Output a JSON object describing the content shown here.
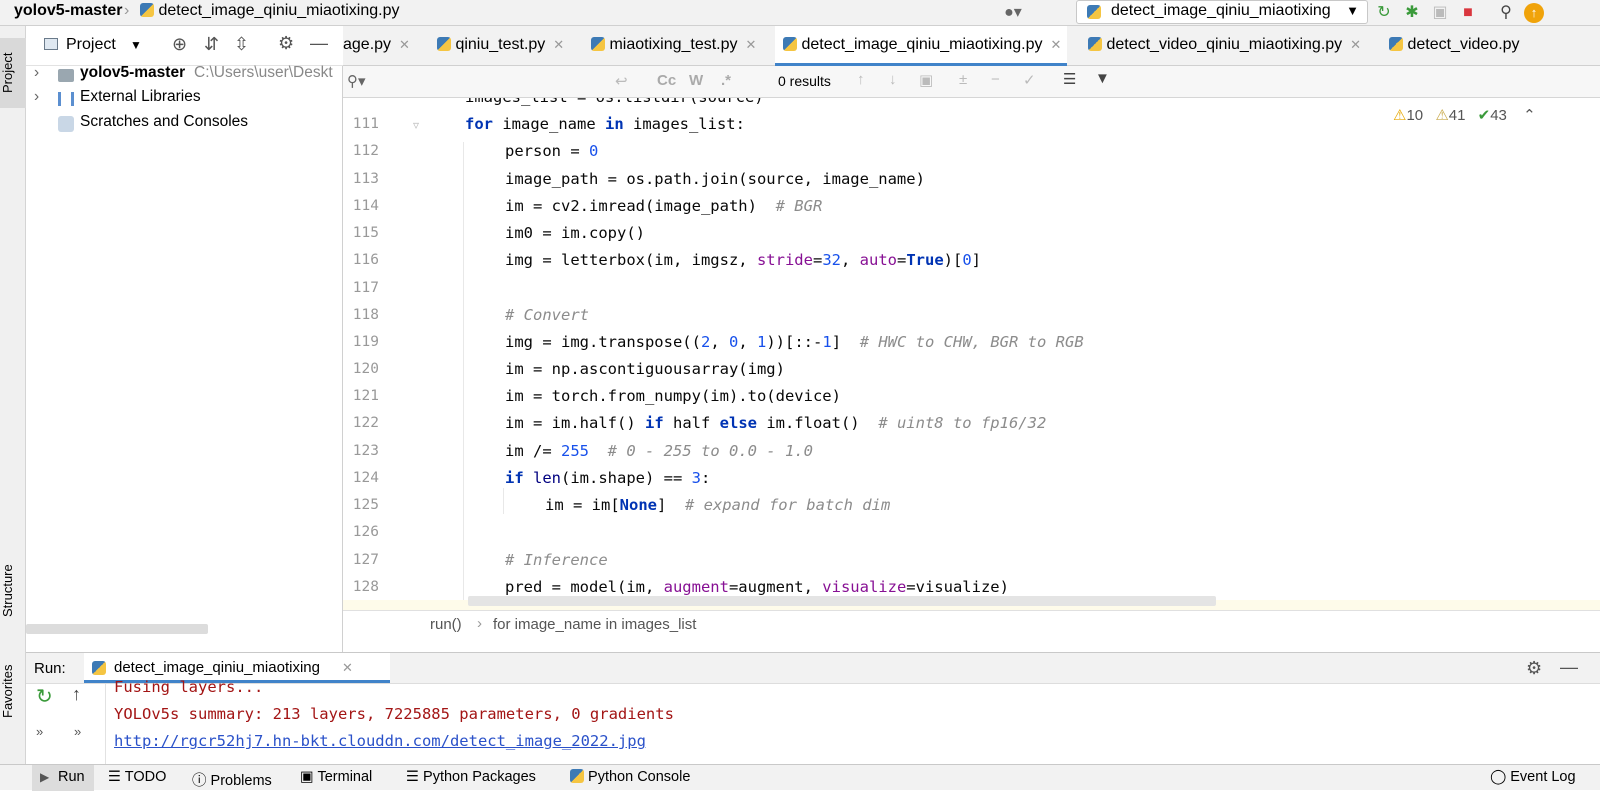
{
  "titlebar": {
    "project": "yolov5-master",
    "file": "detect_image_qiniu_miaotixing.py",
    "run_config": "detect_image_qiniu_miaotixing"
  },
  "sidebar_strip": {
    "project": "Project",
    "structure": "Structure",
    "favorites": "Favorites"
  },
  "project_panel": {
    "title": "Project",
    "items": [
      {
        "label": "yolov5-master",
        "path": "C:\\Users\\user\\Deskt"
      },
      {
        "label": "External Libraries"
      },
      {
        "label": "Scratches and Consoles"
      }
    ]
  },
  "tabs": [
    {
      "label": "age.py"
    },
    {
      "label": "qiniu_test.py"
    },
    {
      "label": "miaotixing_test.py"
    },
    {
      "label": "detect_image_qiniu_miaotixing.py"
    },
    {
      "label": "detect_video_qiniu_miaotixing.py"
    },
    {
      "label": "detect_video.py"
    }
  ],
  "find": {
    "placeholder": "Q•",
    "results": "0 results",
    "cc": "Cc",
    "w": "W",
    "regex": ".*"
  },
  "inspections": {
    "warnings": "10",
    "weak": "41",
    "ok": "43"
  },
  "code": {
    "partial": "images_list = os.listdir(source)",
    "lines": [
      {
        "n": "111"
      },
      {
        "n": "112"
      },
      {
        "n": "113"
      },
      {
        "n": "114"
      },
      {
        "n": "115"
      },
      {
        "n": "116"
      },
      {
        "n": "117"
      },
      {
        "n": "118"
      },
      {
        "n": "119"
      },
      {
        "n": "120"
      },
      {
        "n": "121"
      },
      {
        "n": "122"
      },
      {
        "n": "123"
      },
      {
        "n": "124"
      },
      {
        "n": "125"
      },
      {
        "n": "126"
      },
      {
        "n": "127"
      },
      {
        "n": "128"
      }
    ],
    "l111": {
      "kw1": "for",
      "t1": " image_name ",
      "kw2": "in",
      "t2": " images_list:"
    },
    "l112": {
      "t1": "person = ",
      "n1": "0"
    },
    "l113": {
      "t1": "image_path = os.path.join(source, image_name)"
    },
    "l114": {
      "t1": "im = cv2.imread(image_path)  ",
      "c1": "# BGR"
    },
    "l115": {
      "t1": "im0 = im.copy()"
    },
    "l116": {
      "t1": "img = letterbox(im, imgsz, ",
      "p1": "stride",
      "t2": "=",
      "n1": "32",
      "t3": ", ",
      "p2": "auto",
      "t4": "=",
      "k1": "True",
      "t5": ")[",
      "n2": "0",
      "t6": "]"
    },
    "l118": {
      "c1": "# Convert"
    },
    "l119": {
      "t1": "img = img.transpose((",
      "n1": "2",
      "t2": ", ",
      "n2": "0",
      "t3": ", ",
      "n3": "1",
      "t4": "))[::-",
      "n4": "1",
      "t5": "]  ",
      "c1": "# HWC to CHW, BGR to RGB"
    },
    "l120": {
      "t1": "im = np.ascontiguousarray(img)"
    },
    "l121": {
      "t1": "im = torch.from_numpy(im).to(device)"
    },
    "l122": {
      "t1": "im = im.half() ",
      "k1": "if",
      "t2": " half ",
      "k2": "else",
      "t3": " im.float()  ",
      "c1": "# uint8 to fp16/32"
    },
    "l123": {
      "t1": "im /= ",
      "n1": "255",
      "t2": "  ",
      "c1": "# 0 - 255 to 0.0 - 1.0"
    },
    "l124": {
      "k1": "if",
      "t1": " ",
      "b1": "len",
      "t2": "(im.shape) == ",
      "n1": "3",
      "t3": ":"
    },
    "l125": {
      "t1": "im = im[",
      "k1": "None",
      "t2": "]  ",
      "c1": "# expand for batch dim"
    },
    "l127": {
      "c1": "# Inference"
    },
    "l128": {
      "t1": "pred = model(im, ",
      "p1": "augment",
      "t2": "=augment, ",
      "p2": "visualize",
      "t3": "=visualize)"
    }
  },
  "breadcrumb": {
    "a": "run()",
    "sep": "›",
    "b": "for image_name in images_list"
  },
  "run": {
    "label": "Run:",
    "tab": "detect_image_qiniu_miaotixing",
    "output": [
      "Fusing layers...",
      "YOLOv5s summary: 213 layers, 7225885 parameters, 0 gradients",
      "http://rgcr52hj7.hn-bkt.clouddn.com/detect_image_2022.jpg"
    ]
  },
  "statusbar": {
    "run": "Run",
    "todo": "TODO",
    "problems": "Problems",
    "terminal": "Terminal",
    "packages": "Python Packages",
    "console": "Python Console",
    "eventlog": "Event Log"
  },
  "colors": {
    "accent": "#4083c9",
    "keyword": "#0033b3",
    "number": "#1750eb",
    "comment": "#8c8c8c",
    "param": "#871094",
    "output": "#a31515",
    "link": "#2a51c9"
  }
}
